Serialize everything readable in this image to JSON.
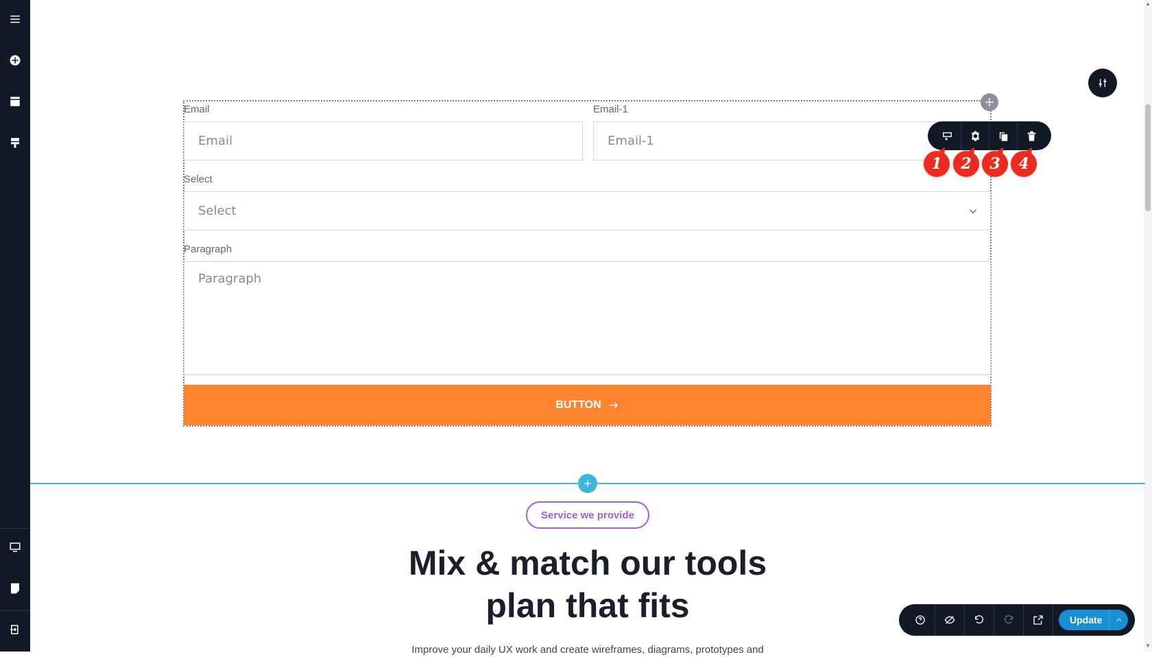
{
  "sidebar": {
    "top_icons": [
      "menu-icon",
      "add-icon",
      "layout-icon",
      "tools-icon"
    ],
    "bottom_icons": [
      "desktop-icon",
      "page-icon",
      "exit-icon"
    ]
  },
  "form": {
    "email_label": "Email",
    "email_placeholder": "Email",
    "email1_label": "Email-1",
    "email1_placeholder": "Email-1",
    "select_label": "Select",
    "select_value": "Select",
    "paragraph_label": "Paragraph",
    "paragraph_placeholder": "Paragraph",
    "button_label": "BUTTON"
  },
  "element_toolbar": {
    "buttons": [
      "edit-section-icon",
      "settings-icon",
      "duplicate-icon",
      "delete-icon"
    ]
  },
  "markers": [
    "1",
    "2",
    "3",
    "4"
  ],
  "section": {
    "pill_label": "Service we provide",
    "heading_line1": "Mix & match our tools",
    "heading_line2": "plan that fits",
    "subtext": "Improve your daily UX work and create wireframes, diagrams, prototypes and"
  },
  "bottom_toolbar": {
    "buttons": [
      "help-icon",
      "hide-icon",
      "undo-icon",
      "redo-icon",
      "preview-icon"
    ],
    "update_label": "Update"
  },
  "colors": {
    "sidebar": "#111826",
    "button": "#fe8430",
    "accent_line": "#3fb5d8",
    "pill": "#a75cd2",
    "marker": "#e92c1f",
    "update": "#1b8fd3"
  }
}
